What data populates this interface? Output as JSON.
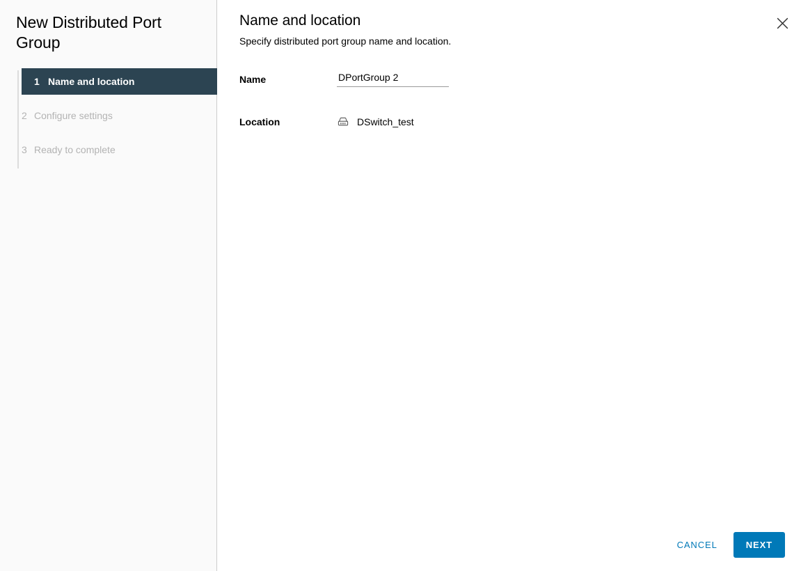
{
  "wizard": {
    "title": "New Distributed Port Group",
    "steps": [
      {
        "number": "1",
        "label": "Name and location",
        "state": "active"
      },
      {
        "number": "2",
        "label": "Configure settings",
        "state": "inactive"
      },
      {
        "number": "3",
        "label": "Ready to complete",
        "state": "inactive"
      }
    ]
  },
  "page": {
    "title": "Name and location",
    "subtitle": "Specify distributed port group name and location.",
    "close_icon": "close-icon"
  },
  "form": {
    "name": {
      "label": "Name",
      "value": "DPortGroup 2",
      "placeholder": ""
    },
    "location": {
      "label": "Location",
      "value": "DSwitch_test",
      "icon": "distributed-switch-icon"
    }
  },
  "footer": {
    "cancel_label": "CANCEL",
    "next_label": "NEXT"
  },
  "colors": {
    "accent": "#0079b8",
    "active_step_bg": "#2c4452",
    "sidebar_bg": "#fafafa",
    "inactive_step_text": "#b3b3b3",
    "divider": "#cccccc"
  }
}
